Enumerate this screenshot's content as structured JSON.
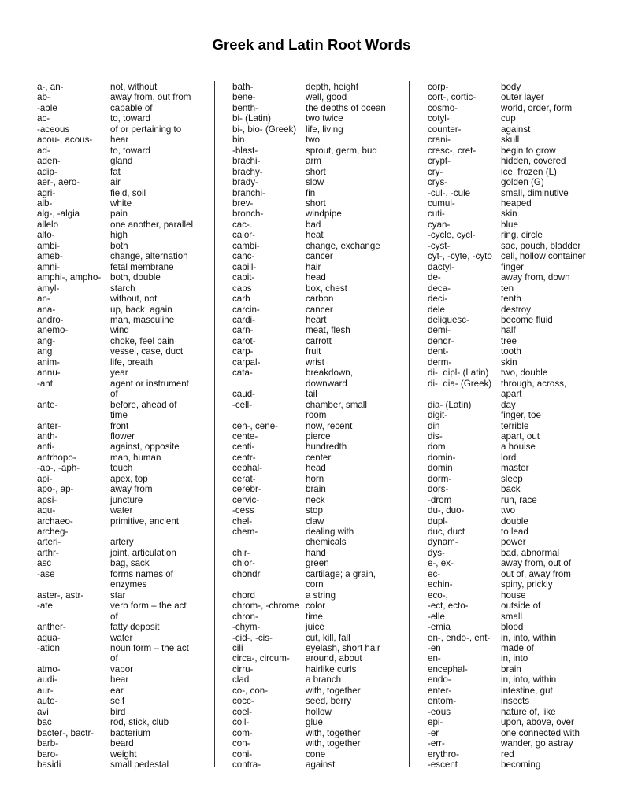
{
  "title": "Greek and Latin Root Words",
  "columns": [
    {
      "entries": [
        {
          "root": "a-, an-",
          "meaning": "not, without"
        },
        {
          "root": "ab-",
          "meaning": "away from, out from"
        },
        {
          "root": "-able",
          "meaning": "capable of"
        },
        {
          "root": "ac-",
          "meaning": "to, toward"
        },
        {
          "root": "-aceous",
          "meaning": "of or pertaining to"
        },
        {
          "root": "acou-, acous-",
          "meaning": "hear"
        },
        {
          "root": "ad-",
          "meaning": "to, toward"
        },
        {
          "root": "aden-",
          "meaning": "gland"
        },
        {
          "root": "adip-",
          "meaning": "fat"
        },
        {
          "root": "aer-, aero-",
          "meaning": "air"
        },
        {
          "root": "agri-",
          "meaning": "field, soil"
        },
        {
          "root": "alb-",
          "meaning": "white"
        },
        {
          "root": "alg-, -algia",
          "meaning": "pain"
        },
        {
          "root": "allelo",
          "meaning": "one another, parallel"
        },
        {
          "root": "alto-",
          "meaning": "high"
        },
        {
          "root": "ambi-",
          "meaning": "both"
        },
        {
          "root": "ameb-",
          "meaning": "change, alternation"
        },
        {
          "root": "amni-",
          "meaning": "fetal membrane"
        },
        {
          "root": "amphi-, ampho-",
          "meaning": "both, double"
        },
        {
          "root": "amyl-",
          "meaning": "starch"
        },
        {
          "root": "an-",
          "meaning": "without, not"
        },
        {
          "root": "ana-",
          "meaning": "up, back, again"
        },
        {
          "root": "andro-",
          "meaning": "man, masculine"
        },
        {
          "root": "anemo-",
          "meaning": "wind"
        },
        {
          "root": "ang-",
          "meaning": "choke, feel pain"
        },
        {
          "root": "ang",
          "meaning": "vessel, case, duct"
        },
        {
          "root": "anim-",
          "meaning": "life, breath"
        },
        {
          "root": "annu-",
          "meaning": "year"
        },
        {
          "root": "-ant",
          "meaning": "agent or instrument\nof"
        },
        {
          "root": "ante-",
          "meaning": "before, ahead of\ntime"
        },
        {
          "root": "anter-",
          "meaning": "front"
        },
        {
          "root": "anth-",
          "meaning": "flower"
        },
        {
          "root": "anti-",
          "meaning": "against, opposite"
        },
        {
          "root": "antrhopo-",
          "meaning": "man, human"
        },
        {
          "root": "-ap-, -aph-",
          "meaning": "touch"
        },
        {
          "root": "api-",
          "meaning": "apex, top"
        },
        {
          "root": "apo-, ap-",
          "meaning": "away from"
        },
        {
          "root": "apsi-",
          "meaning": "juncture"
        },
        {
          "root": "aqu-",
          "meaning": "water"
        },
        {
          "root": "archaeo-",
          "meaning": "primitive, ancient"
        },
        {
          "root": "archeg-",
          "meaning": ""
        },
        {
          "root": "arteri-",
          "meaning": "artery"
        },
        {
          "root": "arthr-",
          "meaning": "joint, articulation"
        },
        {
          "root": "asc",
          "meaning": "bag, sack"
        },
        {
          "root": "-ase",
          "meaning": "forms names of\nenzymes"
        },
        {
          "root": "aster-, astr-",
          "meaning": "star"
        },
        {
          "root": "-ate",
          "meaning": "verb form – the act\nof"
        },
        {
          "root": "anther-",
          "meaning": "fatty deposit"
        },
        {
          "root": "aqua-",
          "meaning": "water"
        },
        {
          "root": "-ation",
          "meaning": "noun form – the act\nof"
        },
        {
          "root": "atmo-",
          "meaning": "vapor"
        },
        {
          "root": "audi-",
          "meaning": "hear"
        },
        {
          "root": "aur-",
          "meaning": "ear"
        },
        {
          "root": "auto-",
          "meaning": "self"
        },
        {
          "root": "avi",
          "meaning": "bird"
        },
        {
          "root": "bac",
          "meaning": "rod, stick, club"
        },
        {
          "root": "bacter-, bactr-",
          "meaning": "bacterium"
        },
        {
          "root": "barb-",
          "meaning": "beard"
        },
        {
          "root": "baro-",
          "meaning": "weight"
        },
        {
          "root": "basidi",
          "meaning": "small pedestal"
        }
      ]
    },
    {
      "entries": [
        {
          "root": "bath-",
          "meaning": "depth, height"
        },
        {
          "root": "bene-",
          "meaning": "well, good"
        },
        {
          "root": "benth-",
          "meaning": "the depths of ocean"
        },
        {
          "root": "bi- (Latin)",
          "meaning": "two twice"
        },
        {
          "root": "bi-, bio- (Greek)",
          "meaning": "life, living"
        },
        {
          "root": "bin",
          "meaning": "two"
        },
        {
          "root": "-blast-",
          "meaning": "sprout, germ, bud"
        },
        {
          "root": "brachi-",
          "meaning": "arm"
        },
        {
          "root": "brachy-",
          "meaning": "short"
        },
        {
          "root": "brady-",
          "meaning": "slow"
        },
        {
          "root": "branchi-",
          "meaning": "fin"
        },
        {
          "root": "brev-",
          "meaning": "short"
        },
        {
          "root": "bronch-",
          "meaning": "windpipe"
        },
        {
          "root": "cac-.",
          "meaning": "bad"
        },
        {
          "root": "calor-",
          "meaning": "heat"
        },
        {
          "root": "cambi-",
          "meaning": "change, exchange"
        },
        {
          "root": "canc-",
          "meaning": "cancer"
        },
        {
          "root": "capill-",
          "meaning": "hair"
        },
        {
          "root": "capit-",
          "meaning": "head"
        },
        {
          "root": "caps",
          "meaning": "box, chest"
        },
        {
          "root": "carb",
          "meaning": "carbon"
        },
        {
          "root": "carcin-",
          "meaning": "cancer"
        },
        {
          "root": "cardi-",
          "meaning": "heart"
        },
        {
          "root": "carn-",
          "meaning": "meat, flesh"
        },
        {
          "root": "carot-",
          "meaning": "carrott"
        },
        {
          "root": "carp-",
          "meaning": "fruit"
        },
        {
          "root": "carpal-",
          "meaning": "wrist"
        },
        {
          "root": "cata-",
          "meaning": "breakdown,\ndownward"
        },
        {
          "root": "caud-",
          "meaning": "tail"
        },
        {
          "root": "-cell-",
          "meaning": "chamber, small\nroom"
        },
        {
          "root": "cen-, cene-",
          "meaning": "now, recent"
        },
        {
          "root": "cente-",
          "meaning": "pierce"
        },
        {
          "root": "centi-",
          "meaning": "hundredth"
        },
        {
          "root": "centr-",
          "meaning": "center"
        },
        {
          "root": "cephal-",
          "meaning": "head"
        },
        {
          "root": "cerat-",
          "meaning": "horn"
        },
        {
          "root": "cerebr-",
          "meaning": "brain"
        },
        {
          "root": "cervic-",
          "meaning": "neck"
        },
        {
          "root": "-cess",
          "meaning": "stop"
        },
        {
          "root": "chel-",
          "meaning": "claw"
        },
        {
          "root": "chem-",
          "meaning": "dealing with\nchemicals"
        },
        {
          "root": "chir-",
          "meaning": "hand"
        },
        {
          "root": "chlor-",
          "meaning": "green"
        },
        {
          "root": "chondr",
          "meaning": "cartilage; a grain,\ncorn"
        },
        {
          "root": "chord",
          "meaning": "a string"
        },
        {
          "root": "chrom-, -chrome",
          "meaning": "color"
        },
        {
          "root": "chron-",
          "meaning": "time"
        },
        {
          "root": "-chym-",
          "meaning": "juice"
        },
        {
          "root": "-cid-, -cis-",
          "meaning": "cut, kill, fall"
        },
        {
          "root": "cili",
          "meaning": "eyelash, short hair"
        },
        {
          "root": "circa-, circum-",
          "meaning": "around, about"
        },
        {
          "root": "cirru-",
          "meaning": "hairlike curls"
        },
        {
          "root": "clad",
          "meaning": "a branch"
        },
        {
          "root": "co-, con-",
          "meaning": "with, together"
        },
        {
          "root": "cocc-",
          "meaning": "seed, berry"
        },
        {
          "root": "coel-",
          "meaning": "hollow"
        },
        {
          "root": "coll-",
          "meaning": "glue"
        },
        {
          "root": "com-",
          "meaning": "with, together"
        },
        {
          "root": "con-",
          "meaning": "with, together"
        },
        {
          "root": "coni-",
          "meaning": "cone"
        },
        {
          "root": "contra-",
          "meaning": "against"
        }
      ]
    },
    {
      "entries": [
        {
          "root": "corp-",
          "meaning": "body"
        },
        {
          "root": "cort-, cortic-",
          "meaning": "outer layer"
        },
        {
          "root": "cosmo-",
          "meaning": "world, order, form"
        },
        {
          "root": "cotyl-",
          "meaning": "cup"
        },
        {
          "root": "counter-",
          "meaning": "against"
        },
        {
          "root": "crani-",
          "meaning": "skull"
        },
        {
          "root": "cresc-, cret-",
          "meaning": "begin to grow"
        },
        {
          "root": "crypt-",
          "meaning": "hidden, covered"
        },
        {
          "root": "cry-",
          "meaning": "ice, frozen (L)"
        },
        {
          "root": "crys-",
          "meaning": "golden (G)"
        },
        {
          "root": "-cul-, -cule",
          "meaning": "small, diminutive"
        },
        {
          "root": "cumul-",
          "meaning": "heaped"
        },
        {
          "root": "cuti-",
          "meaning": "skin"
        },
        {
          "root": "cyan-",
          "meaning": "blue"
        },
        {
          "root": "-cycle, cycl-",
          "meaning": "ring, circle"
        },
        {
          "root": "-cyst-",
          "meaning": "sac, pouch, bladder"
        },
        {
          "root": "cyt-, -cyte, -cyto",
          "meaning": "cell, hollow container"
        },
        {
          "root": "dactyl-",
          "meaning": "finger"
        },
        {
          "root": "de-",
          "meaning": "away from, down"
        },
        {
          "root": "deca-",
          "meaning": "ten"
        },
        {
          "root": "deci-",
          "meaning": "tenth"
        },
        {
          "root": "dele",
          "meaning": "destroy"
        },
        {
          "root": "deliquesc-",
          "meaning": "become fluid"
        },
        {
          "root": "demi-",
          "meaning": "half"
        },
        {
          "root": "dendr-",
          "meaning": "tree"
        },
        {
          "root": "dent-",
          "meaning": "tooth"
        },
        {
          "root": "derm-",
          "meaning": "skin"
        },
        {
          "root": "di-, dipl- (Latin)",
          "meaning": "two, double"
        },
        {
          "root": "di-, dia- (Greek)",
          "meaning": "through, across,\napart"
        },
        {
          "root": "dia- (Latin)",
          "meaning": "day"
        },
        {
          "root": "digit-",
          "meaning": "finger, toe"
        },
        {
          "root": "din",
          "meaning": "terrible"
        },
        {
          "root": "dis-",
          "meaning": "apart, out"
        },
        {
          "root": "dom",
          "meaning": "a houise"
        },
        {
          "root": "domin-",
          "meaning": "lord"
        },
        {
          "root": "domin",
          "meaning": "master"
        },
        {
          "root": "dorm-",
          "meaning": "sleep"
        },
        {
          "root": "dors-",
          "meaning": "back"
        },
        {
          "root": "-drom",
          "meaning": "run, race"
        },
        {
          "root": "du-, duo-",
          "meaning": "two"
        },
        {
          "root": "dupl-",
          "meaning": "double"
        },
        {
          "root": "duc, duct",
          "meaning": "to lead"
        },
        {
          "root": "dynam-",
          "meaning": "power"
        },
        {
          "root": "dys-",
          "meaning": "bad, abnormal"
        },
        {
          "root": "e-, ex-",
          "meaning": "away from, out of"
        },
        {
          "root": "ec-",
          "meaning": "out of, away from"
        },
        {
          "root": "echin-",
          "meaning": "spiny, prickly"
        },
        {
          "root": "eco-,",
          "meaning": "house"
        },
        {
          "root": "-ect, ecto-",
          "meaning": "outside of"
        },
        {
          "root": "-elle",
          "meaning": "small"
        },
        {
          "root": "-emia",
          "meaning": "blood"
        },
        {
          "root": "en-, endo-, ent-",
          "meaning": "in, into, within"
        },
        {
          "root": "-en",
          "meaning": "made of"
        },
        {
          "root": "en-",
          "meaning": "in, into"
        },
        {
          "root": "encephal-",
          "meaning": "brain"
        },
        {
          "root": "endo-",
          "meaning": "in, into, within"
        },
        {
          "root": "enter-",
          "meaning": "intestine, gut"
        },
        {
          "root": "entom-",
          "meaning": "insects"
        },
        {
          "root": "-eous",
          "meaning": "nature of, like"
        },
        {
          "root": "epi-",
          "meaning": "upon, above, over"
        },
        {
          "root": "-er",
          "meaning": "one connected with"
        },
        {
          "root": "-err-",
          "meaning": "wander, go astray"
        },
        {
          "root": "erythro-",
          "meaning": "red"
        },
        {
          "root": "-escent",
          "meaning": "becoming"
        }
      ]
    }
  ]
}
